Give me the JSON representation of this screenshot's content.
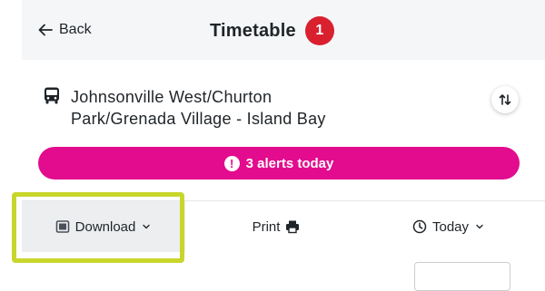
{
  "header": {
    "back_label": "Back",
    "title": "Timetable",
    "badge_count": "1"
  },
  "route": {
    "icon": "bus-icon",
    "name": "Johnsonville West/Churton Park/Grenada Village - Island Bay",
    "swap_icon": "swap-direction-icon"
  },
  "alerts": {
    "icon_glyph": "!",
    "label": "3 alerts today"
  },
  "toolbar": {
    "download_label": "Download",
    "print_label": "Print",
    "today_label": "Today"
  },
  "colors": {
    "badge": "#d9202f",
    "alerts_bar": "#e30b8e",
    "highlight": "#c8d62c",
    "header_bg": "#f5f6f7",
    "download_bg": "#eceef0"
  }
}
